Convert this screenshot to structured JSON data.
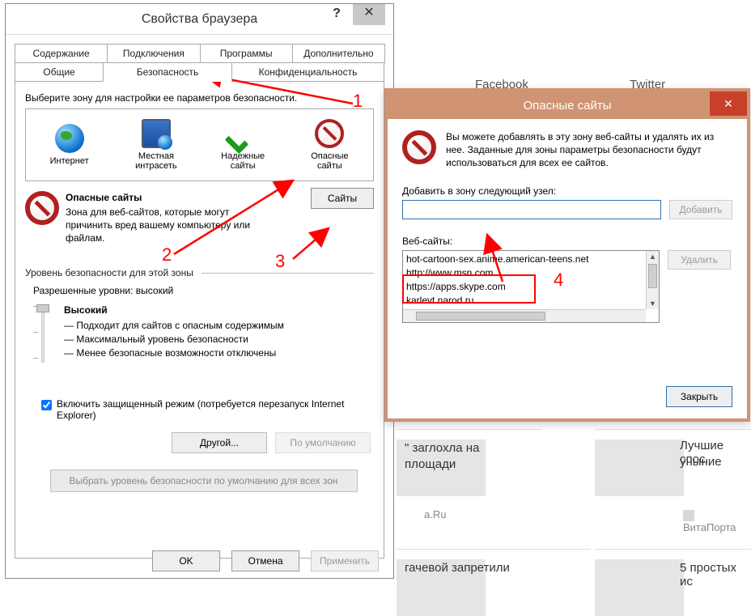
{
  "props": {
    "title": "Свойства браузера",
    "help_symbol": "?",
    "close_symbol": "✕",
    "tabs_row1": [
      "Содержание",
      "Подключения",
      "Программы",
      "Дополнительно"
    ],
    "tabs_row2": [
      "Общие",
      "Безопасность",
      "Конфиденциальность"
    ],
    "active_tab": "Безопасность",
    "zone_select_label": "Выберите зону для настройки ее параметров безопасности.",
    "zones": [
      {
        "name": "Интернет"
      },
      {
        "name1": "Местная",
        "name2": "интрасеть"
      },
      {
        "name1": "Надежные",
        "name2": "сайты"
      },
      {
        "name1": "Опасные",
        "name2": "сайты"
      }
    ],
    "zone_desc_title": "Опасные сайты",
    "zone_desc_text": "Зона для веб-сайтов, которые могут причинить вред вашему компьютеру или файлам.",
    "sites_button": "Сайты",
    "level_group_label": "Уровень безопасности для этой зоны",
    "allowed_levels": "Разрешенные уровни: высокий",
    "level_name": "Высокий",
    "level_bullets": [
      "— Подходит для сайтов с опасным содержимым",
      "— Максимальный уровень безопасности",
      "— Менее безопасные возможности отключены"
    ],
    "protected_mode": "Включить защищенный режим (потребуется перезапуск Internet Explorer)",
    "btn_custom": "Другой...",
    "btn_default": "По умолчанию",
    "btn_default_all": "Выбрать уровень безопасности по умолчанию для всех зон",
    "footer": {
      "ok": "OK",
      "cancel": "Отмена",
      "apply": "Применить"
    }
  },
  "sites": {
    "title": "Опасные сайты",
    "close_symbol": "✕",
    "intro": "Вы можете добавлять в эту зону  веб-сайты и удалять их из нее. Заданные для зоны параметры безопасности будут использоваться для всех ее сайтов.",
    "add_label": "Добавить в зону следующий узел:",
    "add_btn": "Добавить",
    "list_label": "Веб-сайты:",
    "list": [
      "hot-cartoon-sex.anime.american-teens.net",
      "http://www.msn.com",
      "https://apps.skype.com",
      "karlevt narod ru"
    ],
    "delete_btn": "Удалить",
    "close_btn": "Закрыть"
  },
  "bg": {
    "fb": "Facebook",
    "tw": "Twitter",
    "card1a": "\" заглохла на",
    "card1b": "площади",
    "card1src": "a.Ru",
    "card2": "гачевой запретили",
    "right1a": "Лучшие спос",
    "right1b": "уныние",
    "right1src": "ВитаПорта",
    "right2": "5 простых ис"
  },
  "annotations": {
    "n1": "1",
    "n2": "2",
    "n3": "3",
    "n4": "4"
  }
}
